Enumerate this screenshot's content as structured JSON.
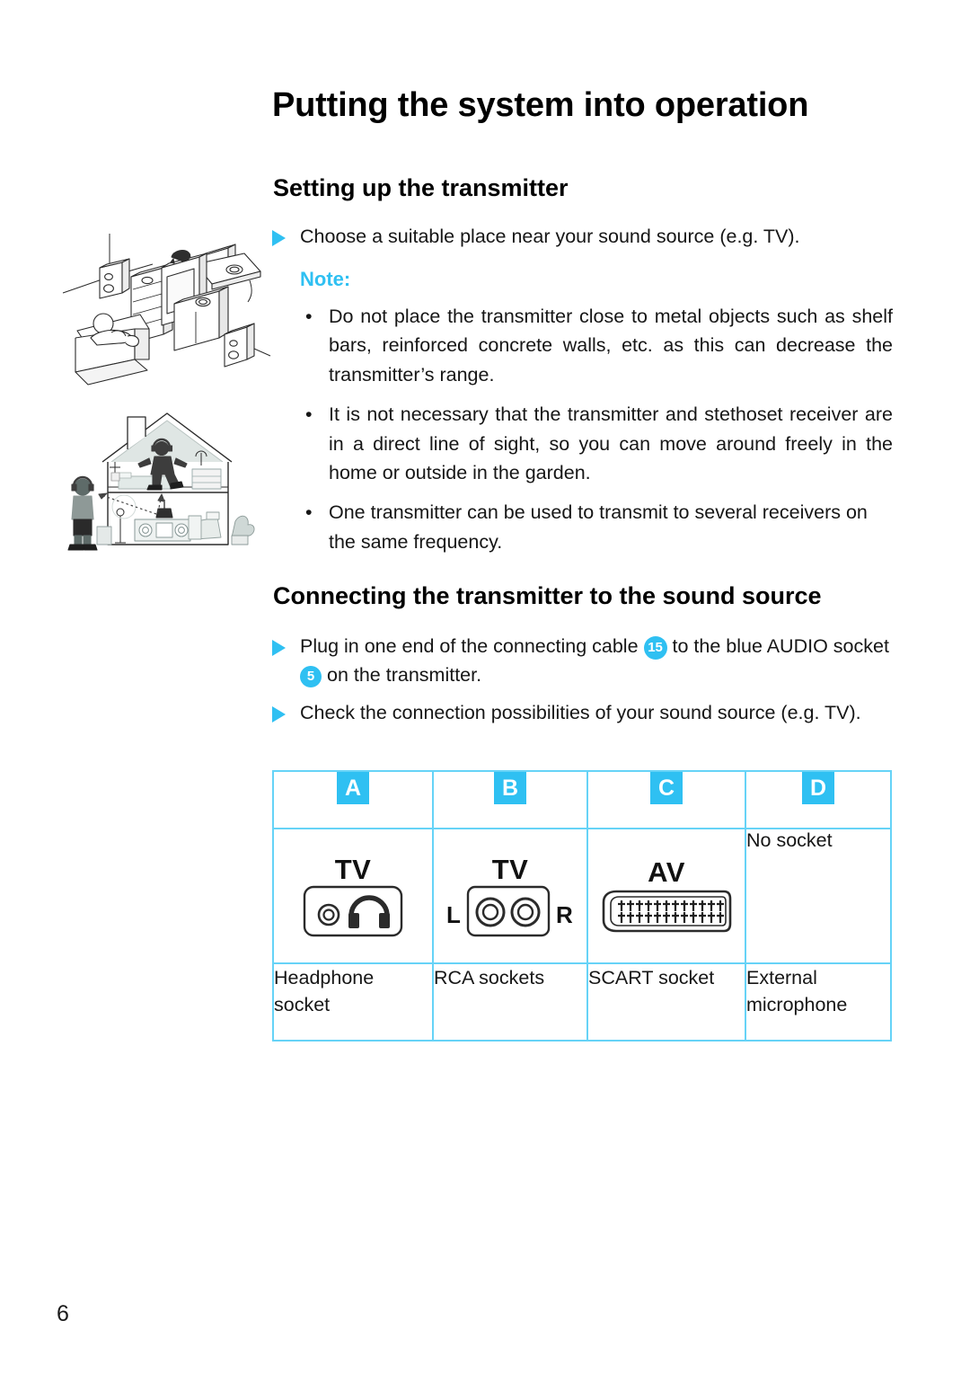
{
  "page": {
    "title": "Putting the system into operation",
    "number": "6",
    "accent_color": "#2fc0f2",
    "table_border_color": "#66d3f7"
  },
  "section_setup": {
    "heading": "Setting up the transmitter",
    "instruction": "Choose a suitable place near your sound source (e.g. TV).",
    "note_label": "Note:",
    "notes": [
      "Do not place the transmitter close to metal objects such as shelf bars, reinforced concrete walls, etc. as this can decrease the transmitter’s range.",
      "It is not necessary that the transmitter and stethoset receiver are in a direct line of sight, so you can move around freely in the home or outside in the garden.",
      "One transmitter can be used to transmit to several receivers on the same frequency."
    ],
    "bullet_glyph": "•"
  },
  "illustrations": [
    {
      "name": "living-room-setup-illustration",
      "alt": "Isometric drawing of a living room with TV, hi-fi rack, loudspeakers and a person in an armchair"
    },
    {
      "name": "house-cross-section-illustration",
      "alt": "Cross-section of a house showing wireless transmission from a hi-fi system to listeners upstairs and outside"
    }
  ],
  "section_connecting": {
    "heading": "Connecting the transmitter to the sound source",
    "steps": [
      {
        "parts": [
          {
            "type": "text",
            "value": "Plug in one end of the connecting cable "
          },
          {
            "type": "badge",
            "value": "15"
          },
          {
            "type": "text",
            "value": " to the blue AUDIO socket "
          },
          {
            "type": "badge",
            "value": "5"
          },
          {
            "type": "text",
            "value": " on the transmitter."
          }
        ],
        "plain": "Plug in one end of the connecting cable 15 to the blue AUDIO socket 5 on the transmitter."
      },
      {
        "parts": [
          {
            "type": "text",
            "value": "Check the connection possibilities of your sound source (e.g. TV)."
          }
        ],
        "plain": "Check the connection possibilities of your sound source (e.g. TV)."
      }
    ],
    "step1_pre": "Plug in one end of the connecting cable",
    "step1_badge1": "15",
    "step1_mid": "to the blue AUDIO socket",
    "step1_badge2": "5",
    "step1_post": "on the transmitter.",
    "step2_text": "Check the connection possibilities of your sound source (e.g. TV)."
  },
  "connection_table": {
    "columns": [
      {
        "letter": "A",
        "icon_name": "headphone-socket-icon",
        "icon_label": "TV",
        "description": "Headphone socket"
      },
      {
        "letter": "B",
        "icon_name": "rca-socket-icon",
        "icon_label": "TV",
        "left_marker": "L",
        "right_marker": "R",
        "description": "RCA sockets"
      },
      {
        "letter": "C",
        "icon_name": "scart-socket-icon",
        "icon_label": "AV",
        "description": "SCART socket"
      },
      {
        "letter": "D",
        "icon_name": "no-socket-text",
        "icon_label": "No socket",
        "description": "External microphone"
      }
    ]
  }
}
